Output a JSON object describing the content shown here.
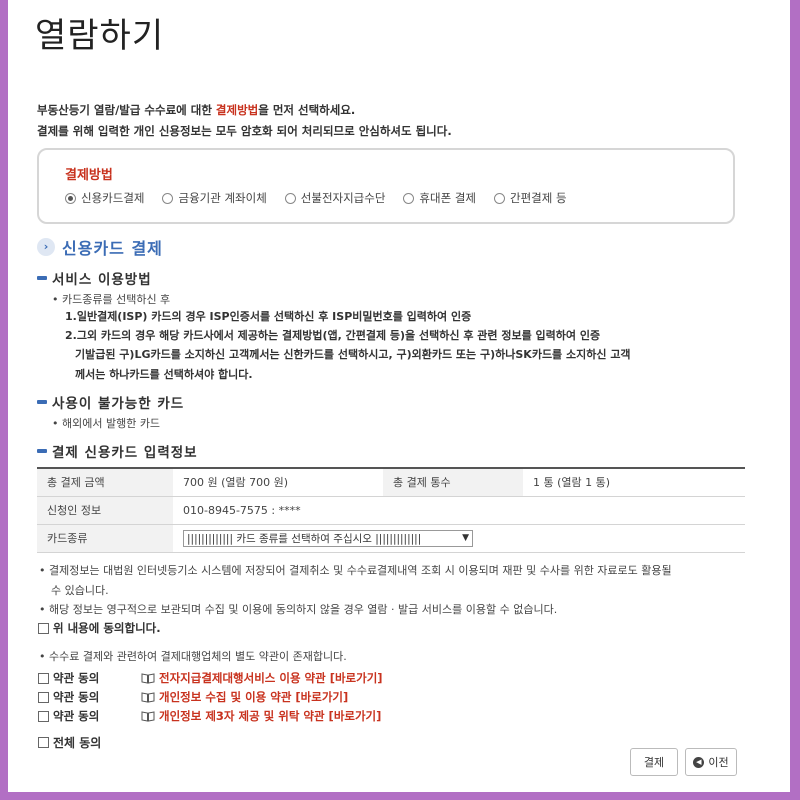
{
  "page": {
    "title": "열람하기"
  },
  "intro": {
    "line1_pre": "부동산등기 열람/발급 수수료에 대한 ",
    "line1_em": "결제방법",
    "line1_post": "을 먼저 선택하세요.",
    "line2": "결제를 위해 입력한 개인 신용정보는 모두 암호화 되어 처리되므로 안심하셔도 됩니다."
  },
  "payment_method": {
    "label": "결제방법",
    "options": [
      "신용카드결제",
      "금융기관 계좌이체",
      "선불전자지급수단",
      "휴대폰 결제",
      "간편결제 등"
    ],
    "selected": "신용카드결제"
  },
  "section": {
    "title": "신용카드 결제"
  },
  "usage": {
    "heading": "서비스 이용방법",
    "bullet": "• 카드종류를 선택하신 후",
    "item1": "1.일반결제(ISP) 카드의 경우 ISP인증서를 선택하신 후 ISP비밀번호를 입력하여 인증",
    "item2a": "2.그외 카드의 경우 해당 카드사에서 제공하는 결제방법(앱, 간편결제 등)을 선택하신 후 관련 정보를 입력하여 인증",
    "item2b": "기발급된 구)LG카드를 소지하신 고객께서는 신한카드를 선택하시고, 구)외환카드 또는 구)하나SK카드를 소지하신 고객",
    "item2c": "께서는 하나카드를 선택하셔야 합니다."
  },
  "unavailable": {
    "heading": "사용이 불가능한 카드",
    "bullet": "• 해외에서 발행한 카드"
  },
  "card_info": {
    "heading": "결제 신용카드 입력정보",
    "total_amount_label": "총 결제 금액",
    "total_amount_value": "700 원 (열람 700 원)",
    "total_count_label": "총 결제 통수",
    "total_count_value": "1 통 (열람 1 통)",
    "applicant_label": "신청인 정보",
    "applicant_value": "010-8945-7575 : ****",
    "card_type_label": "카드종류",
    "card_type_value": "||||||||||||| 카드 종류를 선택하여 주십시오 |||||||||||||"
  },
  "notes": {
    "n1a": "• 결제정보는 대법원 인터넷등기소 시스템에 저장되어 결제취소 및 수수료결제내역 조회 시 이용되며 재판 및 수사를 위한 자료로도 활용될",
    "n1b": "수 있습니다.",
    "n2": "• 해당 정보는 영구적으로 보관되며 수집 및 이용에 동의하지 않을 경우 열람 · 발급 서비스를 이용할 수 없습니다.",
    "agree_above": "위 내용에 동의합니다.",
    "n3": "• 수수료 결제와 관련하여 결제대행업체의 별도 약관이 존재합니다."
  },
  "terms": [
    {
      "label": "약관 동의",
      "link": "전자지급결제대행서비스 이용 약관 [바로가기]"
    },
    {
      "label": "약관 동의",
      "link": "개인정보 수집 및 이용 약관 [바로가기]"
    },
    {
      "label": "약관 동의",
      "link": "개인정보 제3자 제공 및 위탁 약관 [바로가기]"
    }
  ],
  "agree_all": "전체 동의",
  "buttons": {
    "pay": "결제",
    "prev": "이전"
  }
}
